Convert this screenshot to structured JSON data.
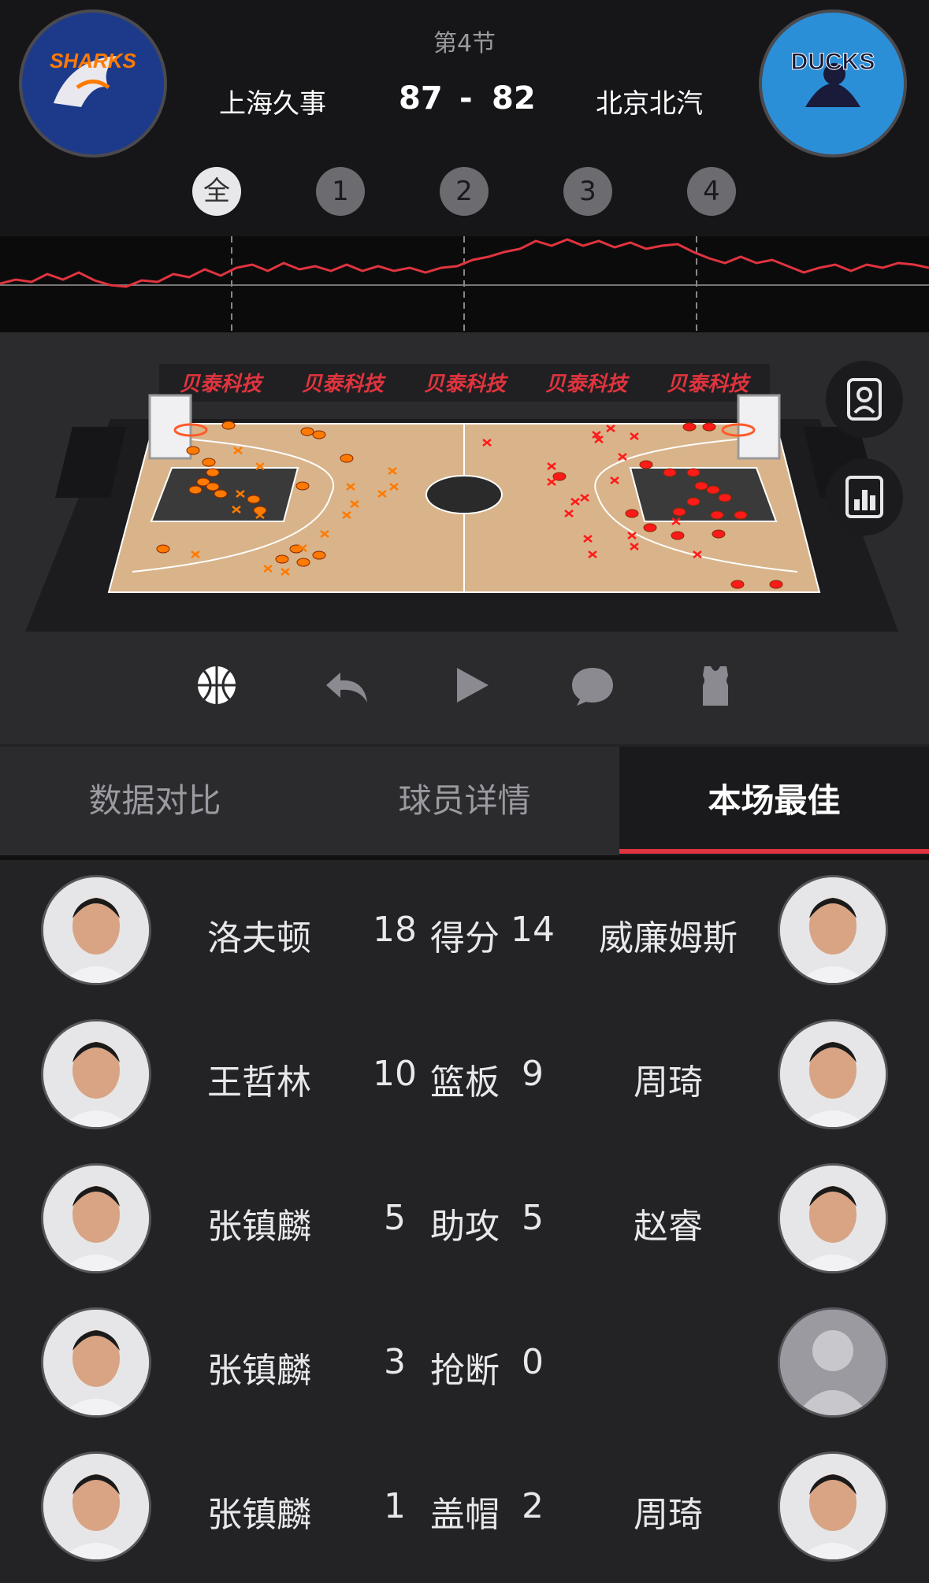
{
  "header": {
    "period": "第4节",
    "home_team": "上海久事",
    "away_team": "北京北汽",
    "home_score": "87",
    "separator": "-",
    "away_score": "82",
    "home_logo_text": "SHARKS",
    "away_logo_text": "DUCKS"
  },
  "quarters": [
    "全",
    "1",
    "2",
    "3",
    "4"
  ],
  "sponsor": [
    "贝泰科技",
    "贝泰科技",
    "贝泰科技",
    "贝泰科技",
    "贝泰科技"
  ],
  "controls": [
    "basketball-icon",
    "undo-icon",
    "play-icon",
    "comment-icon",
    "jersey-icon"
  ],
  "side_buttons": [
    "player-card-icon",
    "stats-chart-icon"
  ],
  "tabs": {
    "compare": "数据对比",
    "players": "球员详情",
    "best": "本场最佳"
  },
  "best": [
    {
      "stat": "得分",
      "home_player": "洛夫顿",
      "home_value": "18",
      "away_value": "14",
      "away_player": "威廉姆斯"
    },
    {
      "stat": "篮板",
      "home_player": "王哲林",
      "home_value": "10",
      "away_value": "9",
      "away_player": "周琦"
    },
    {
      "stat": "助攻",
      "home_player": "张镇麟",
      "home_value": "5",
      "away_value": "5",
      "away_player": "赵睿"
    },
    {
      "stat": "抢断",
      "home_player": "张镇麟",
      "home_value": "3",
      "away_value": "0",
      "away_player": ""
    },
    {
      "stat": "盖帽",
      "home_player": "张镇麟",
      "home_value": "1",
      "away_value": "2",
      "away_player": "周琦"
    }
  ],
  "colors": {
    "accent": "#e0343e",
    "home_shot": "#ff7a00",
    "away_shot": "#ff1a1a",
    "trend": "#e0343e"
  }
}
